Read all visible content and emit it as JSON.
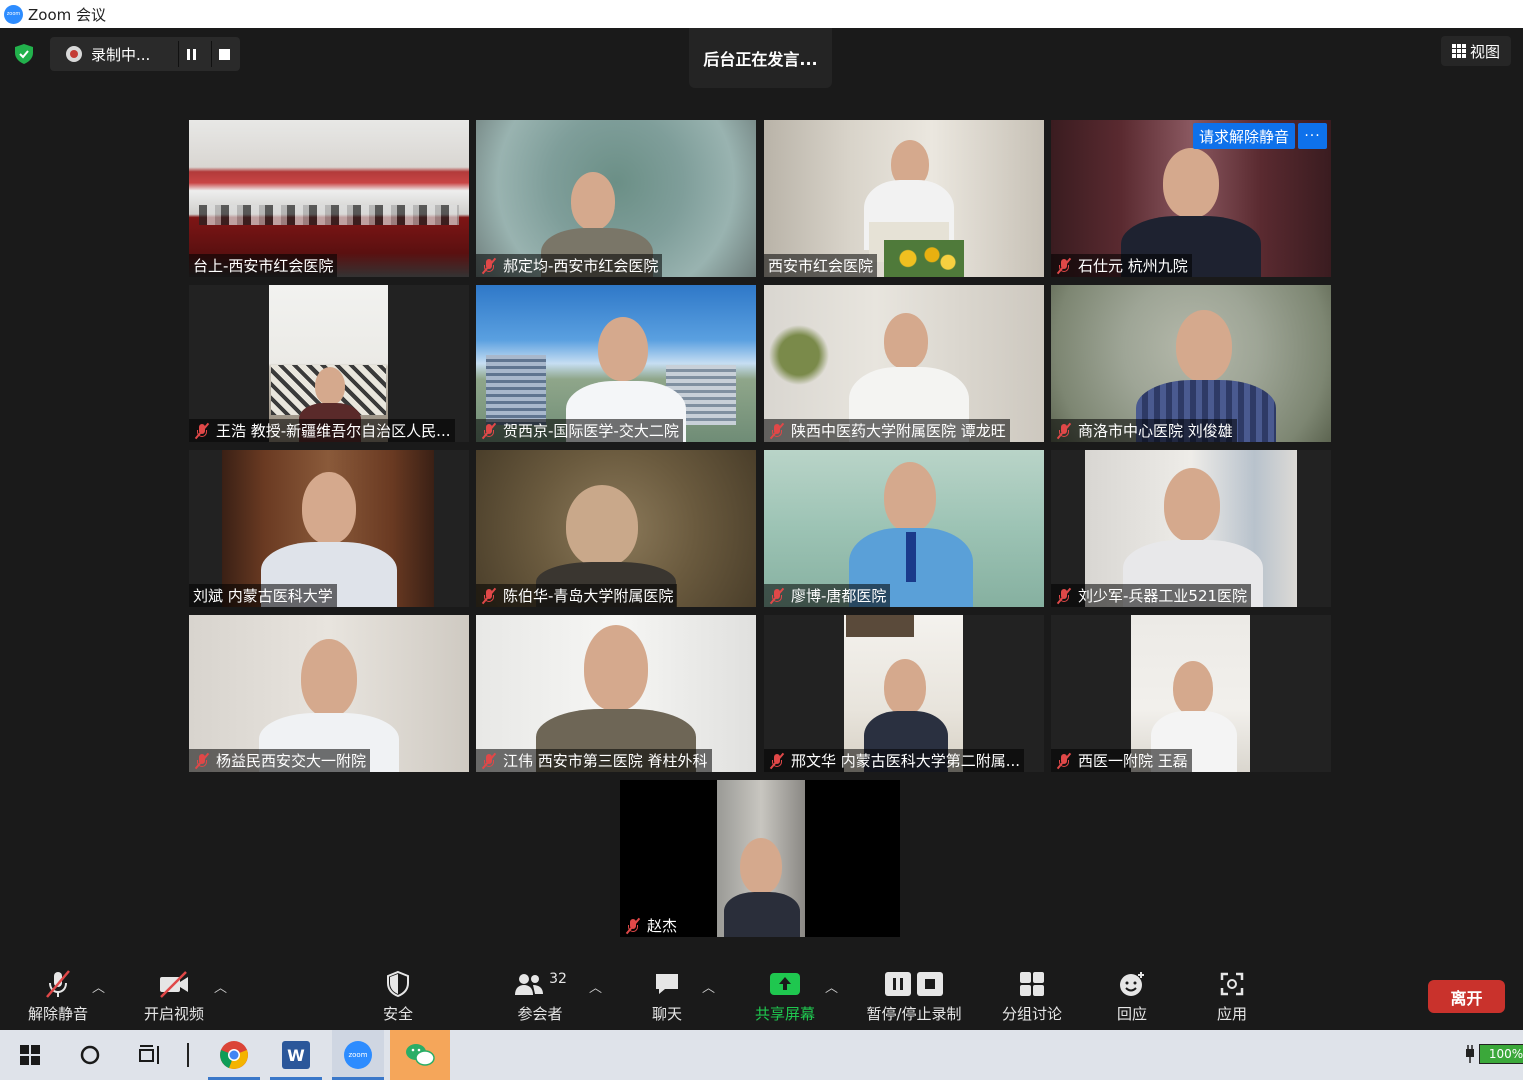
{
  "window": {
    "title": "Zoom 会议",
    "logo_text": "zoom"
  },
  "top": {
    "recording_label": "录制中...",
    "speaking_banner": "后台正在发言...",
    "view_label": "视图"
  },
  "participants": [
    {
      "name": "台上-西安市红会医院",
      "muted": false
    },
    {
      "name": "郝定均-西安市红会医院",
      "muted": true
    },
    {
      "name": "西安市红会医院",
      "muted": false
    },
    {
      "name": "石仕元 杭州九院",
      "muted": true,
      "unmute_request": "请求解除静音",
      "more": "···"
    },
    {
      "name": "王浩 教授-新疆维吾尔自治区人民...",
      "muted": true
    },
    {
      "name": "贺西京-国际医学-交大二院",
      "muted": true
    },
    {
      "name": "陕西中医药大学附属医院 谭龙旺",
      "muted": true
    },
    {
      "name": "商洛市中心医院 刘俊雄",
      "muted": true
    },
    {
      "name": "刘斌 内蒙古医科大学",
      "muted": false
    },
    {
      "name": "陈伯华-青岛大学附属医院",
      "muted": true
    },
    {
      "name": "廖博-唐都医院",
      "muted": true
    },
    {
      "name": "刘少军-兵器工业521医院",
      "muted": true
    },
    {
      "name": "杨益民西安交大一附院",
      "muted": true
    },
    {
      "name": "江伟 西安市第三医院 脊柱外科",
      "muted": true
    },
    {
      "name": "邢文华 内蒙古医科大学第二附属...",
      "muted": true
    },
    {
      "name": "西医一附院 王磊",
      "muted": true
    },
    {
      "name": "赵杰",
      "muted": true
    }
  ],
  "toolbar": {
    "unmute": "解除静音",
    "start_video": "开启视频",
    "security": "安全",
    "participants": "参会者",
    "participants_count": "32",
    "chat": "聊天",
    "share_screen": "共享屏幕",
    "pause_stop_recording": "暂停/停止录制",
    "breakout": "分组讨论",
    "reactions": "回应",
    "apps": "应用",
    "leave": "离开"
  },
  "taskbar": {
    "battery": "100%",
    "zoom_text": "zoom",
    "word_letter": "W"
  },
  "colors": {
    "share_green": "#1fc74f",
    "leave_red": "#c9322c",
    "request_blue": "#0e71eb",
    "muted_red": "#e04848"
  }
}
